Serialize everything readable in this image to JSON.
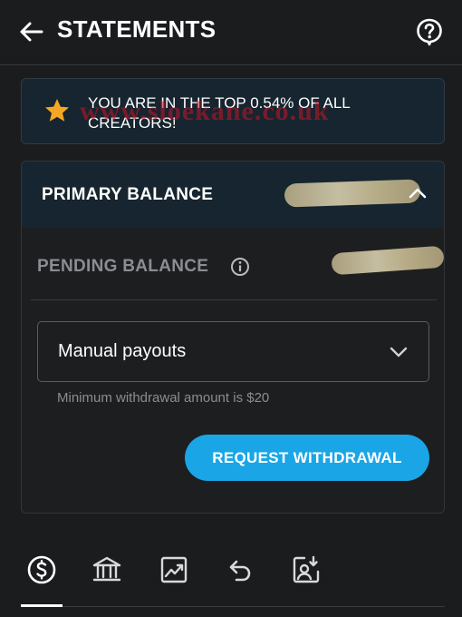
{
  "header": {
    "title": "STATEMENTS",
    "back_icon": "arrow-left-icon",
    "help_icon": "help-icon"
  },
  "banner": {
    "icon": "star-icon",
    "text": "YOU ARE IN THE TOP 0.54% OF ALL CREATORS!",
    "watermark": "www.sloekane.co.uk",
    "star_color": "#f5a623"
  },
  "balances": {
    "primary_label": "PRIMARY BALANCE",
    "pending_label": "PENDING BALANCE"
  },
  "payout": {
    "selected": "Manual payouts",
    "minimum_note": "Minimum withdrawal amount is $20",
    "request_label": "REQUEST WITHDRAWAL"
  },
  "tabs": [
    {
      "icon": "dollar-circle-icon",
      "active": true
    },
    {
      "icon": "bank-icon",
      "active": false
    },
    {
      "icon": "chart-up-icon",
      "active": false
    },
    {
      "icon": "refund-icon",
      "active": false
    },
    {
      "icon": "profile-download-icon",
      "active": false
    }
  ],
  "colors": {
    "background": "#1b1c1e",
    "accent": "#1aa6e6",
    "banner_bg": "#16252f",
    "muted_text": "#8a8d92"
  }
}
